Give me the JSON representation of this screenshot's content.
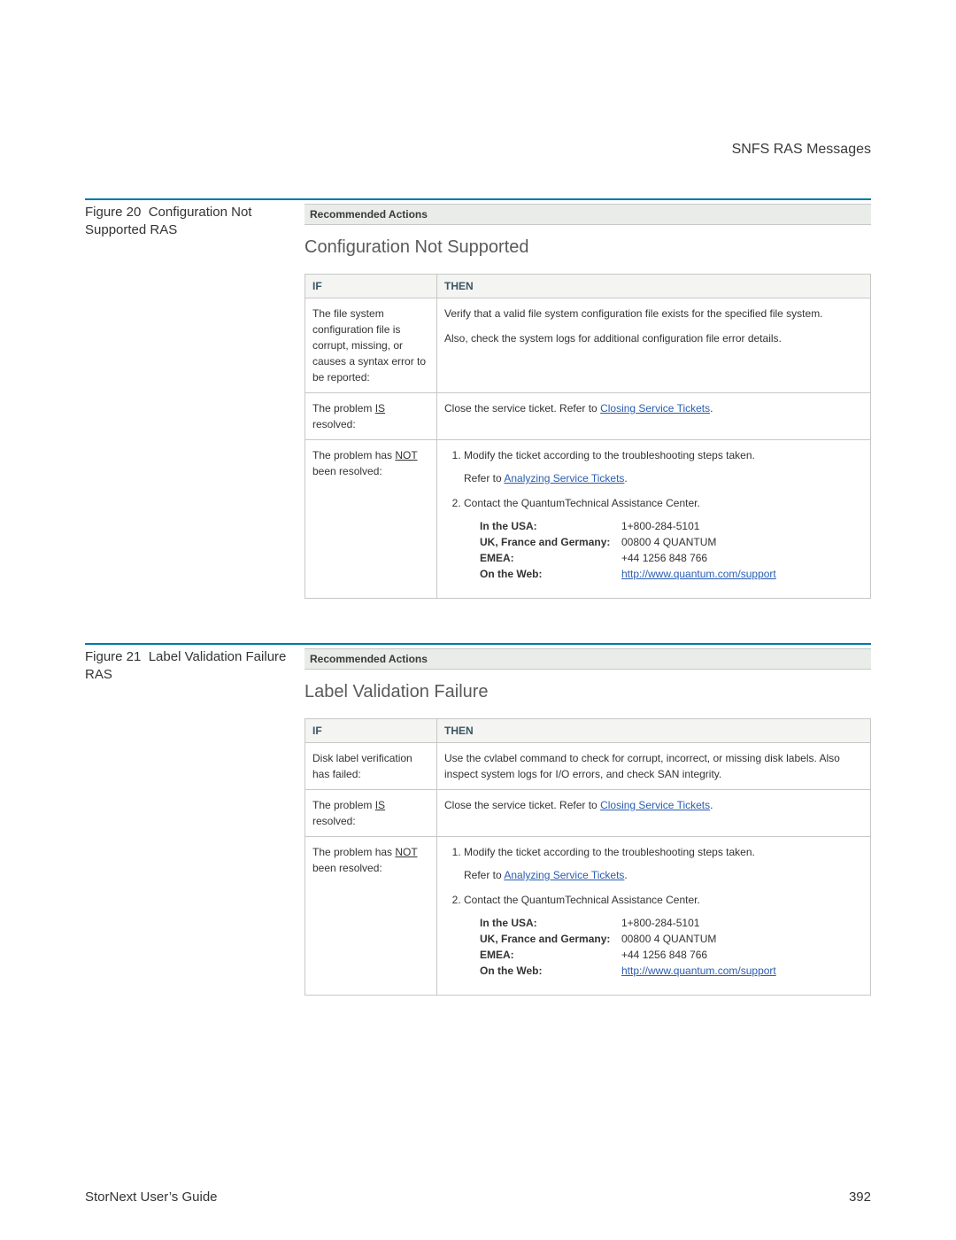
{
  "header": {
    "section_title": "SNFS RAS Messages"
  },
  "figures": [
    {
      "caption_prefix": "Figure 20",
      "caption_rest": "Configuration Not Supported RAS",
      "recommended_label": "Recommended Actions",
      "panel_title": "Configuration Not Supported",
      "cols": {
        "if": "IF",
        "then": "THEN"
      },
      "row1": {
        "if": "The file system configuration file is corrupt, missing, or causes a syntax error to be reported:",
        "then_line1": "Verify that a valid file system configuration file exists for the specified file system.",
        "then_line2": "Also, check the system logs for additional configuration file error details."
      },
      "row2": {
        "if_pre": "The problem ",
        "if_is": "IS",
        "if_post": " resolved:",
        "then_pre": "Close the service ticket. Refer to ",
        "then_link": "Closing Service Tickets",
        "then_post": "."
      },
      "row3": {
        "if_pre": "The problem has ",
        "if_not": "NOT",
        "if_post": " been resolved:",
        "step1": "Modify the ticket according to the troubleshooting steps taken.",
        "step1_refer_pre": "Refer to ",
        "step1_refer_link": "Analyzing Service Tickets",
        "step1_refer_post": ".",
        "step2": "Contact the QuantumTechnical Assistance Center.",
        "contacts": {
          "usa_label": "In the USA:",
          "usa_value": "1+800-284-5101",
          "ukfg_label": "UK, France and Germany:",
          "ukfg_value": "00800 4 QUANTUM",
          "emea_label": "EMEA:",
          "emea_value": "+44 1256 848 766",
          "web_label": "On the Web:",
          "web_value": "http://www.quantum.com/support"
        }
      }
    },
    {
      "caption_prefix": "Figure 21",
      "caption_rest": "Label Validation Failure RAS",
      "recommended_label": "Recommended Actions",
      "panel_title": "Label Validation Failure",
      "cols": {
        "if": "IF",
        "then": "THEN"
      },
      "row1": {
        "if": "Disk label verification has failed:",
        "then_line1": "Use the cvlabel command to check for corrupt, incorrect, or missing disk labels. Also inspect system logs for I/O errors, and check SAN integrity.",
        "then_line2": ""
      },
      "row2": {
        "if_pre": "The problem ",
        "if_is": "IS",
        "if_post": " resolved:",
        "then_pre": "Close the service ticket. Refer to ",
        "then_link": "Closing Service Tickets",
        "then_post": "."
      },
      "row3": {
        "if_pre": "The problem has ",
        "if_not": "NOT",
        "if_post": " been resolved:",
        "step1": "Modify the ticket according to the troubleshooting steps taken.",
        "step1_refer_pre": "Refer to ",
        "step1_refer_link": "Analyzing Service Tickets",
        "step1_refer_post": ".",
        "step2": "Contact the QuantumTechnical Assistance Center.",
        "contacts": {
          "usa_label": "In the USA:",
          "usa_value": "1+800-284-5101",
          "ukfg_label": "UK, France and Germany:",
          "ukfg_value": "00800 4 QUANTUM",
          "emea_label": "EMEA:",
          "emea_value": "+44 1256 848 766",
          "web_label": "On the Web:",
          "web_value": "http://www.quantum.com/support"
        }
      }
    }
  ],
  "footer": {
    "left": "StorNext User’s Guide",
    "right": "392"
  }
}
